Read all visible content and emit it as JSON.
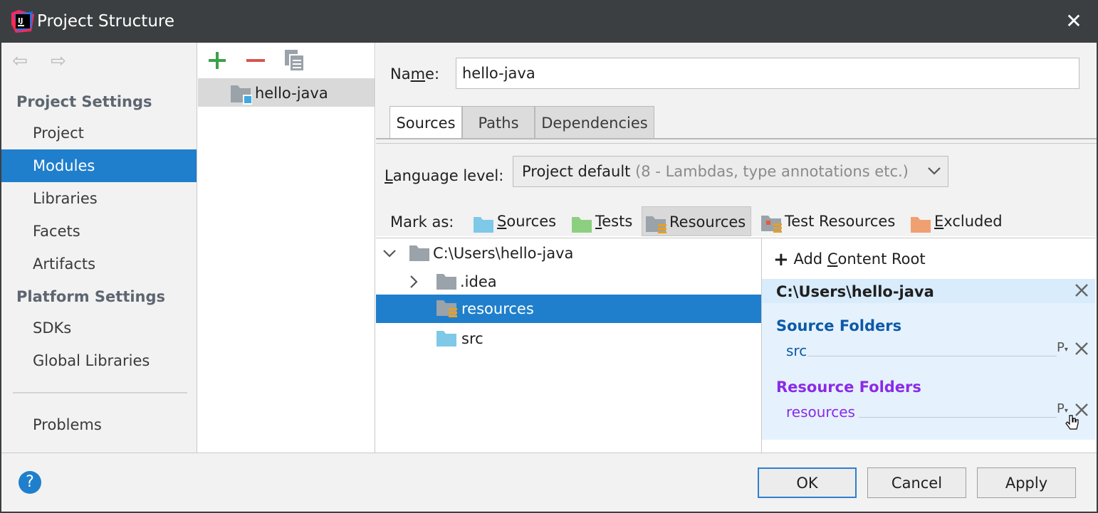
{
  "window": {
    "title": "Project Structure",
    "close_icon": "close-icon"
  },
  "sidebar": {
    "nav": {
      "back_icon": "arrow-left-icon",
      "forward_icon": "arrow-right-icon"
    },
    "project_settings_header": "Project Settings",
    "project_items": [
      {
        "label": "Project"
      },
      {
        "label": "Modules",
        "active": true
      },
      {
        "label": "Libraries"
      },
      {
        "label": "Facets"
      },
      {
        "label": "Artifacts"
      }
    ],
    "platform_settings_header": "Platform Settings",
    "platform_items": [
      {
        "label": "SDKs"
      },
      {
        "label": "Global Libraries"
      }
    ],
    "problems_label": "Problems"
  },
  "modules": {
    "toolbar": {
      "add_icon": "plus-icon",
      "remove_icon": "minus-icon",
      "copy_icon": "copy-icon"
    },
    "items": [
      {
        "label": "hello-java"
      }
    ]
  },
  "module_settings": {
    "name_label_pre": "Na",
    "name_label_mn": "m",
    "name_label_post": "e:",
    "name_value": "hello-java",
    "tabs": [
      {
        "label": "Sources",
        "active": true
      },
      {
        "label": "Paths"
      },
      {
        "label": "Dependencies"
      }
    ],
    "language_level_label_first": "L",
    "language_level_label_rest": "anguage level:",
    "language_level_value": "Project default",
    "language_level_hint": "(8 - Lambdas, type annotations etc.)",
    "mark_as_label": "Mark as:",
    "mark_as": [
      {
        "first": "S",
        "rest": "ources",
        "color": "#7ec8e8"
      },
      {
        "first": "T",
        "rest": "ests",
        "color": "#8dcf80"
      },
      {
        "first": "",
        "rest": "Resources",
        "color": "#9aa2aa",
        "pressed": true
      },
      {
        "first": "",
        "rest": "Test Resources",
        "color": "#9aa2aa"
      },
      {
        "first": "E",
        "rest": "xcluded",
        "color": "#f0a070"
      }
    ],
    "tree": [
      {
        "label": "C:\\Users\\hello-java",
        "expanded": true
      },
      {
        "label": ".idea",
        "collapsed": true
      },
      {
        "label": "resources",
        "selected": true
      },
      {
        "label": "src"
      }
    ],
    "content_roots": {
      "add_label_pre": "Add ",
      "add_label_mn": "C",
      "add_label_post": "ontent Root",
      "root_path": "C:\\Users\\hello-java",
      "source_folders_title": "Source Folders",
      "source_folders": [
        "src"
      ],
      "resource_folders_title": "Resource Folders",
      "resource_folders": [
        "resources"
      ],
      "properties_glyph": "P",
      "source_color": "#0d5aa7",
      "resource_color": "#8b2ae8"
    }
  },
  "footer": {
    "help_label": "?",
    "ok_label": "OK",
    "cancel_label": "Cancel",
    "apply_label": "Apply"
  },
  "colors": {
    "accent": "#1f7fcc",
    "titlebar": "#3c3f41"
  }
}
